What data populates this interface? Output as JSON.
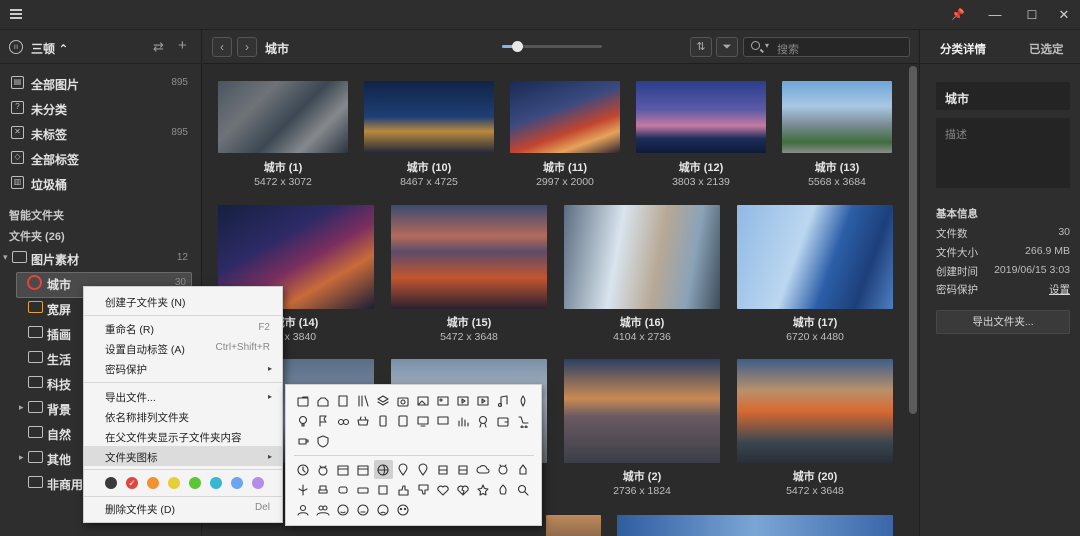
{
  "app": {
    "menu_icon": "hamburger-icon"
  },
  "window": {
    "pin": "📌",
    "min": "—",
    "max": "☐",
    "close": "✕"
  },
  "library": {
    "name": "三顿 ⌃",
    "swap": "⇄",
    "add": "+"
  },
  "nav": [
    {
      "label": "全部图片",
      "count": "895",
      "icon": "all-images-icon"
    },
    {
      "label": "未分类",
      "count": "",
      "icon": "uncategorized-icon"
    },
    {
      "label": "未标签",
      "count": "895",
      "icon": "untagged-icon"
    },
    {
      "label": "全部标签",
      "count": "",
      "icon": "all-tags-icon"
    },
    {
      "label": "垃圾桶",
      "count": "",
      "icon": "trash-icon"
    }
  ],
  "sections": {
    "smart": "智能文件夹",
    "folders": "文件夹 (26)"
  },
  "folders": [
    {
      "label": "图片素材",
      "count": "12",
      "expand": "▾"
    },
    {
      "label": "城市",
      "count": "30",
      "expand": ""
    },
    {
      "label": "宽屏",
      "count": "",
      "expand": ""
    },
    {
      "label": "插画",
      "count": "",
      "expand": ""
    },
    {
      "label": "生活",
      "count": "",
      "expand": ""
    },
    {
      "label": "科技",
      "count": "",
      "expand": ""
    },
    {
      "label": "背景",
      "count": "",
      "expand": "▸"
    },
    {
      "label": "自然",
      "count": "",
      "expand": ""
    },
    {
      "label": "其他",
      "count": "",
      "expand": "▸"
    },
    {
      "label": "非商用",
      "count": "",
      "expand": ""
    }
  ],
  "toolbar": {
    "back": "‹",
    "forward": "›",
    "breadcrumb": "城市",
    "zoom": 0.15,
    "sort": "⇅",
    "filter": "⏷",
    "search_placeholder": "搜索"
  },
  "grid": [
    {
      "name": "城市 (1)",
      "dim": "5472 x 3072"
    },
    {
      "name": "城市 (10)",
      "dim": "8467 x 4725"
    },
    {
      "name": "城市 (11)",
      "dim": "2997 x 2000"
    },
    {
      "name": "城市 (12)",
      "dim": "3803 x 2139"
    },
    {
      "name": "城市 (13)",
      "dim": "5568 x 3684"
    },
    {
      "name": "城市 (14)",
      "dim": "0 x 3840"
    },
    {
      "name": "城市 (15)",
      "dim": "5472 x 3648"
    },
    {
      "name": "城市 (16)",
      "dim": "4104 x 2736"
    },
    {
      "name": "城市 (17)",
      "dim": "6720 x 4480"
    },
    {
      "name": "城市 (2)",
      "dim": "2736 x 1824"
    },
    {
      "name": "城市 (20)",
      "dim": "5472 x 3648"
    }
  ],
  "right": {
    "tab_details": "分类详情",
    "tab_selected": "已选定",
    "name_value": "城市",
    "desc_placeholder": "描述",
    "basic_info": "基本信息",
    "rows": [
      {
        "k": "文件数",
        "v": "30"
      },
      {
        "k": "文件大小",
        "v": "266.9 MB"
      },
      {
        "k": "创建时间",
        "v": "2019/06/15 3:03"
      },
      {
        "k": "密码保护",
        "v": "设置"
      }
    ],
    "export_btn": "导出文件夹..."
  },
  "context_menu": {
    "items": [
      {
        "label": "创建子文件夹 (N)",
        "shortcut": "",
        "sub": ""
      },
      {
        "label": "重命名 (R)",
        "shortcut": "F2",
        "sub": ""
      },
      {
        "label": "设置自动标签 (A)",
        "shortcut": "Ctrl+Shift+R",
        "sub": ""
      },
      {
        "label": "密码保护",
        "shortcut": "",
        "sub": "▸"
      },
      {
        "label": "导出文件...",
        "shortcut": "",
        "sub": "▸"
      },
      {
        "label": "依名称排列文件夹",
        "shortcut": "",
        "sub": ""
      },
      {
        "label": "在父文件夹显示子文件夹内容",
        "shortcut": "",
        "sub": ""
      },
      {
        "label": "文件夹图标",
        "shortcut": "",
        "sub": "▸"
      },
      {
        "label": "删除文件夹 (D)",
        "shortcut": "Del",
        "sub": ""
      }
    ],
    "colors": [
      "#3a3a3a",
      "#e0463f",
      "#f0922d",
      "#e6cf36",
      "#5cc63a",
      "#37b8d0",
      "#6aa7ef",
      "#b48de8"
    ]
  }
}
